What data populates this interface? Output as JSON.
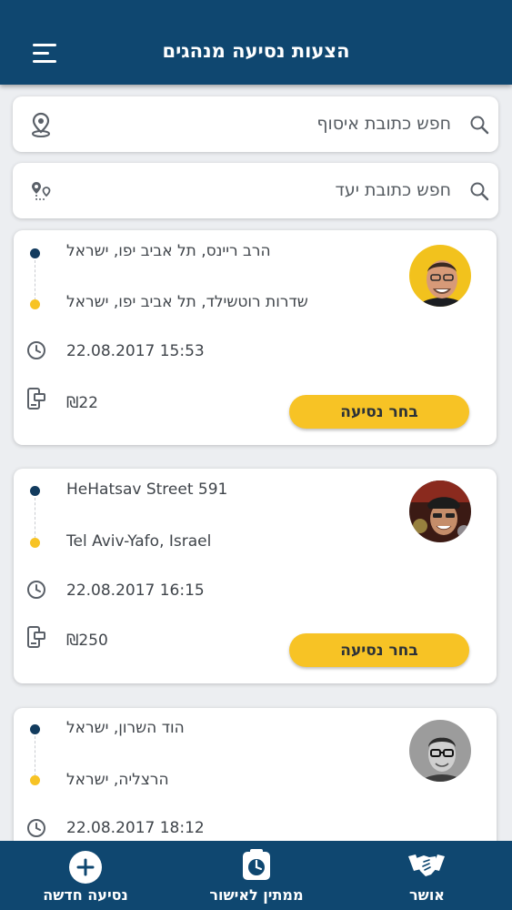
{
  "header": {
    "title": "הצעות נסיעה מנהגים"
  },
  "search": {
    "pickup_placeholder": "חפש כתובת איסוף",
    "destination_placeholder": "חפש כתובת יעד"
  },
  "rides": [
    {
      "origin": "הרב ריינס, תל אביב יפו, ישראל",
      "destination": "שדרות רוטשילד, תל אביב יפו, ישראל",
      "datetime": "22.08.2017 15:53",
      "price": "₪22",
      "select_label": "בחר נסיעה"
    },
    {
      "origin": "HeHatsav Street 591",
      "destination": "Tel Aviv-Yafo, Israel",
      "datetime": "22.08.2017 16:15",
      "price": "₪250",
      "select_label": "בחר נסיעה"
    },
    {
      "origin": "הוד השרון, ישראל",
      "destination": "הרצליה, ישראל",
      "datetime": "22.08.2017 18:12"
    }
  ],
  "bottom_nav": {
    "new_ride": "נסיעה חדשה",
    "pending": "ממתין לאישור",
    "approved": "אושר"
  },
  "colors": {
    "primary": "#0f4770",
    "accent": "#f7c325",
    "route_start": "#123b5e",
    "background": "#eceef1"
  },
  "icons": [
    "menu-icon",
    "search-icon",
    "location-pin-icon",
    "route-pins-icon",
    "clock-icon",
    "payment-icon",
    "plus-circle-icon",
    "timer-icon",
    "handshake-icon"
  ]
}
